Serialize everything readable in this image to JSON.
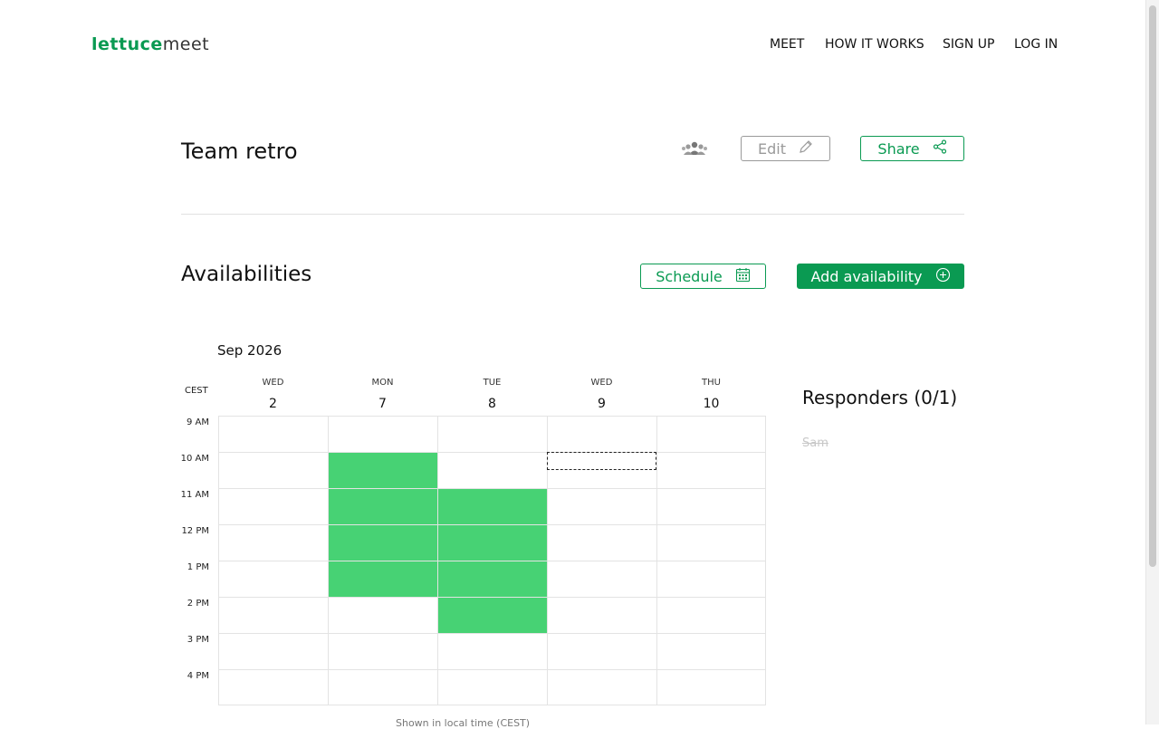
{
  "nav": {
    "logo_bold": "lettuce",
    "logo_light": "meet",
    "links": [
      "MEET",
      "HOW IT WORKS",
      "SIGN UP",
      "LOG IN"
    ]
  },
  "event": {
    "title": "Team retro",
    "edit_label": "Edit",
    "share_label": "Share"
  },
  "availabilities": {
    "title": "Availabilities",
    "schedule_label": "Schedule",
    "add_label": "Add availability"
  },
  "calendar": {
    "month": "Sep 2026",
    "timezone": "CEST",
    "days": [
      {
        "name": "WED",
        "num": "2"
      },
      {
        "name": "MON",
        "num": "7"
      },
      {
        "name": "TUE",
        "num": "8"
      },
      {
        "name": "WED",
        "num": "9"
      },
      {
        "name": "THU",
        "num": "10"
      }
    ],
    "times": [
      "9 AM",
      "10 AM",
      "11 AM",
      "12 PM",
      "1 PM",
      "2 PM",
      "3 PM",
      "4 PM"
    ],
    "available_blocks": [
      {
        "day": "7",
        "from": "10 AM",
        "to": "2 PM"
      },
      {
        "day": "8",
        "from": "11 AM",
        "to": "3 PM"
      }
    ],
    "available_color": "#47d274"
  },
  "responders": {
    "title": "Responders (0/1)",
    "names": [
      "Sam"
    ]
  },
  "footer_note": "Shown in local time (CEST)",
  "colors": {
    "brand": "#0a9a52",
    "available": "#47d274"
  }
}
